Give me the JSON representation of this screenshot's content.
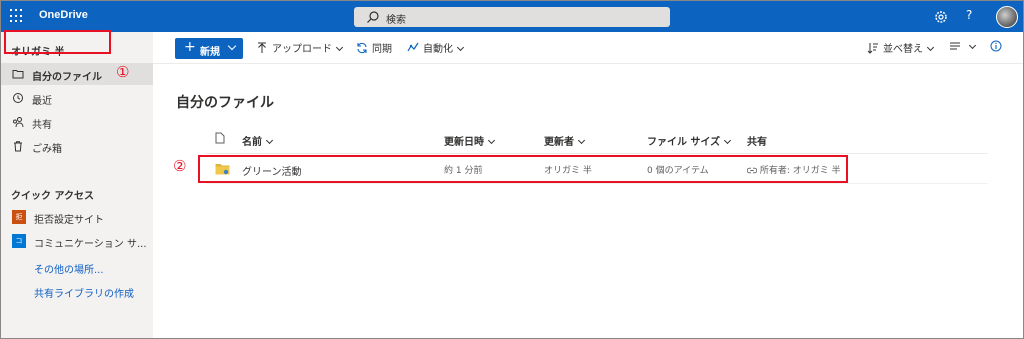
{
  "app": {
    "name": "OneDrive"
  },
  "search": {
    "placeholder": "検索"
  },
  "header": {
    "help_label": "?"
  },
  "sidebar": {
    "user_name": "オリガミ 半",
    "items": [
      {
        "label": "自分のファイル",
        "icon": "folder-icon",
        "active": true
      },
      {
        "label": "最近",
        "icon": "history-icon"
      },
      {
        "label": "共有",
        "icon": "shared-people-icon"
      },
      {
        "label": "ごみ箱",
        "icon": "trash-icon"
      }
    ],
    "quick_access_title": "クイック アクセス",
    "quick_access": [
      {
        "label": "拒否設定サイト",
        "badge": "拒",
        "color": "#ca5010"
      },
      {
        "label": "コミュニケーション サ...",
        "badge": "コ",
        "color": "#0078d4"
      }
    ],
    "more_places": "その他の場所...",
    "create_library": "共有ライブラリの作成"
  },
  "toolbar": {
    "new_label": "新規",
    "upload_label": "アップロード",
    "sync_label": "同期",
    "automate_label": "自動化",
    "sort_label": "並べ替え"
  },
  "main": {
    "title": "自分のファイル",
    "columns": {
      "name": "名前",
      "modified": "更新日時",
      "modified_by": "更新者",
      "size": "ファイル サイズ",
      "sharing": "共有"
    },
    "rows": [
      {
        "name": "グリーン活動",
        "modified": "約 1 分前",
        "modified_by": "オリガミ 半",
        "size": "0 個のアイテム",
        "sharing": "所有者: オリガミ 半"
      }
    ]
  },
  "annotations": {
    "marker1": "①",
    "marker2": "②"
  },
  "colors": {
    "accent": "#0c64c0",
    "highlight": "#e81123",
    "sidebar": "#f3f2f1"
  }
}
